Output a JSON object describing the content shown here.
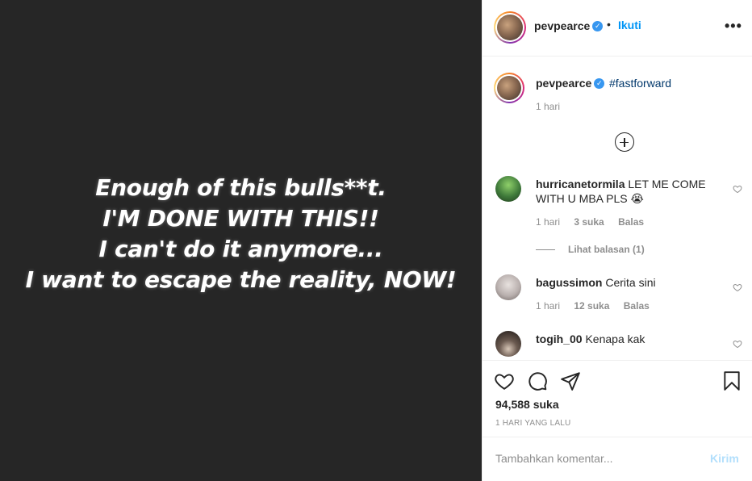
{
  "media": {
    "lines": [
      "Enough of this bulls**t.",
      "I'M DONE WITH THIS!!",
      "I can't do it anymore...",
      "I want to escape the reality, NOW!"
    ]
  },
  "header": {
    "username": "pevpearce",
    "verified_glyph": "✓",
    "dot": "•",
    "follow_label": "Ikuti",
    "more_glyph": "•••"
  },
  "caption": {
    "username": "pevpearce",
    "verified_glyph": "✓",
    "text": "#fastforward",
    "time": "1 hari"
  },
  "comments": [
    {
      "username": "hurricanetormila",
      "text": "LET ME COME WITH U MBA PLS 😭",
      "time": "1 hari",
      "likes": "3 suka",
      "reply": "Balas",
      "avatar_color": "#3f7a3a"
    },
    {
      "username": "bagussimon",
      "text": "Cerita sini",
      "time": "1 hari",
      "likes": "12 suka",
      "reply": "Balas",
      "avatar_color": "#b9b0ae"
    },
    {
      "username": "togih_00",
      "text": "Kenapa kak",
      "avatar_color": "#2b2522"
    }
  ],
  "view_replies": "Lihat balasan (1)",
  "actions": {
    "icons": [
      "heart-icon",
      "comment-icon",
      "share-icon",
      "bookmark-icon"
    ],
    "likes": "94,588 suka",
    "date": "1 HARI YANG LALU"
  },
  "comment_box": {
    "placeholder": "Tambahkan komentar...",
    "post_label": "Kirim"
  },
  "colors": {
    "accent": "#0095f6",
    "verified": "#3897f0",
    "media_bg": "#262626",
    "hashtag": "#00376b"
  }
}
